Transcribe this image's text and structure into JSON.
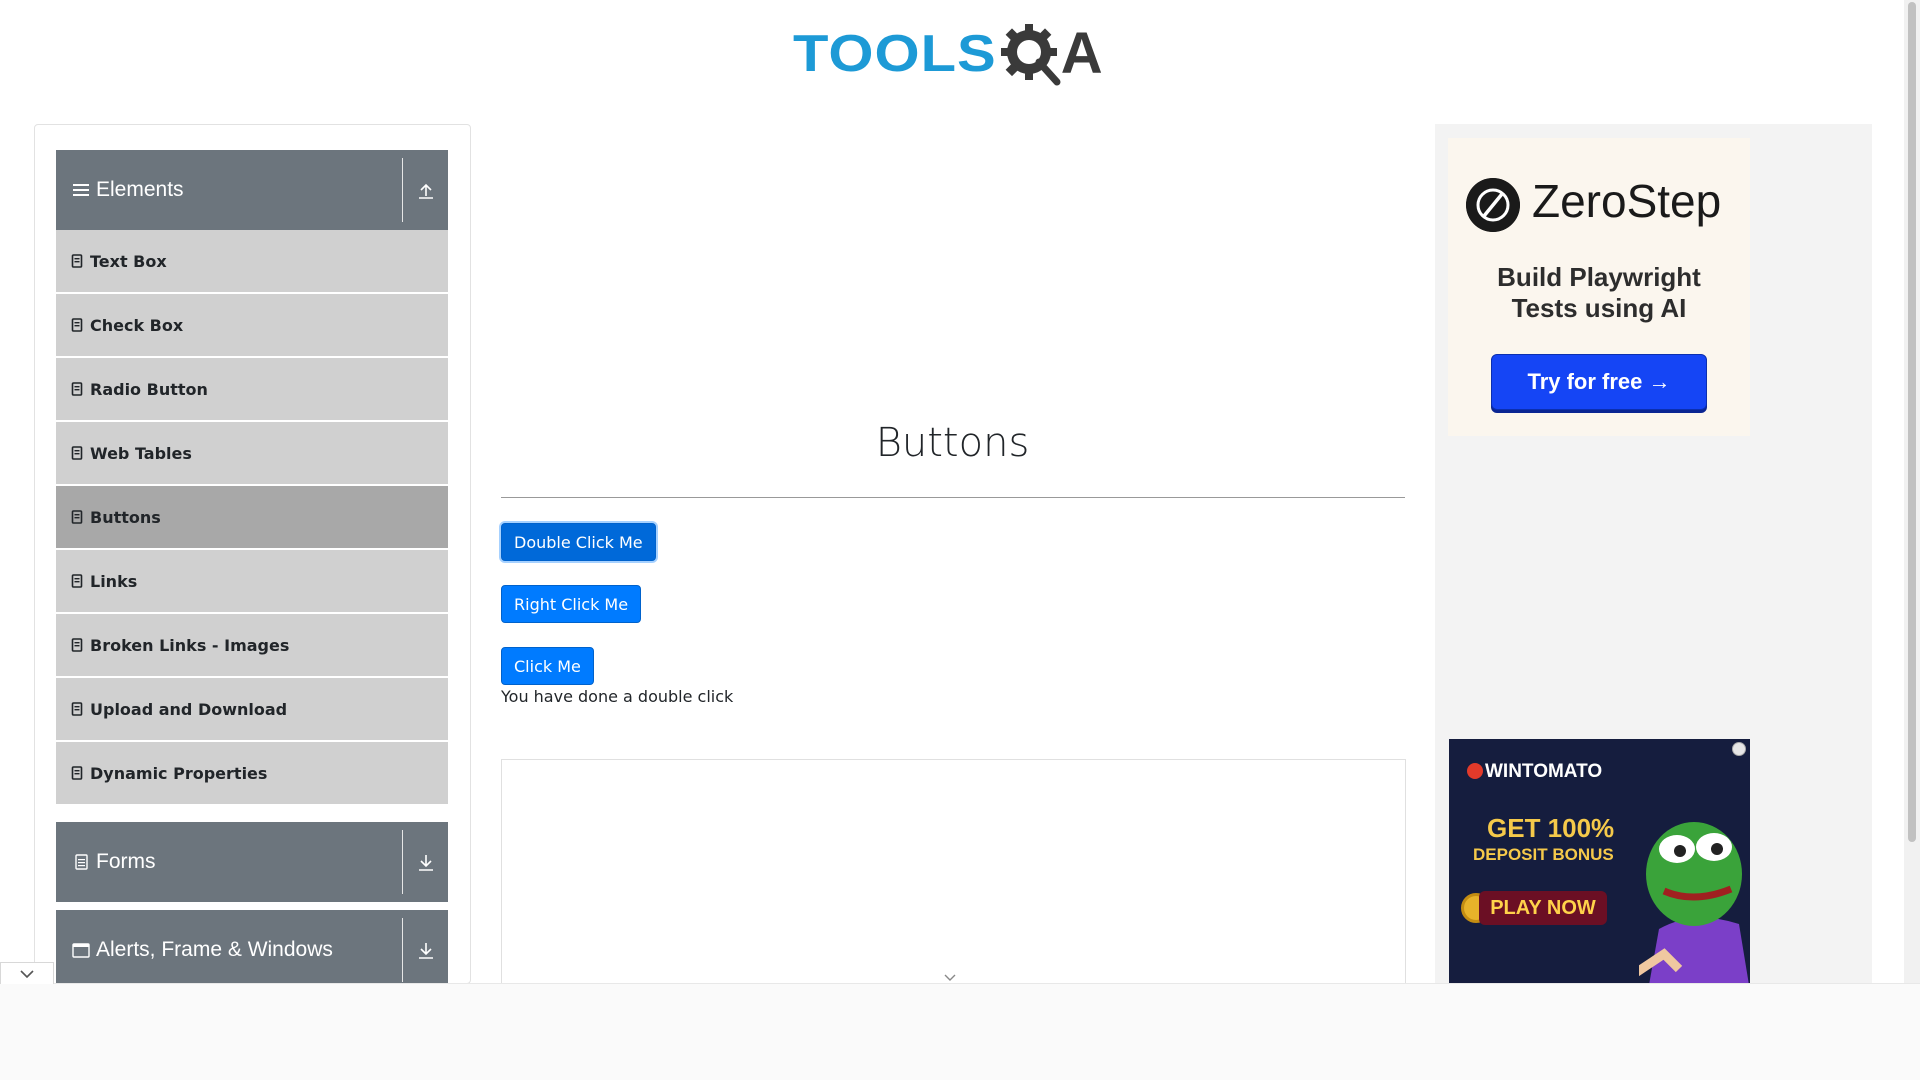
{
  "header": {
    "logo_text_tools": "TOOLS",
    "logo_text_a": "A"
  },
  "sidebar": {
    "groups": [
      {
        "title": "Elements",
        "icon": "hamburger-icon",
        "state": "expanded"
      },
      {
        "title": "Forms",
        "icon": "document-icon",
        "state": "collapsed"
      },
      {
        "title": "Alerts, Frame & Windows",
        "icon": "window-icon",
        "state": "collapsed"
      }
    ],
    "items": [
      {
        "label": "Text Box",
        "active": false
      },
      {
        "label": "Check Box",
        "active": false
      },
      {
        "label": "Radio Button",
        "active": false
      },
      {
        "label": "Web Tables",
        "active": false
      },
      {
        "label": "Buttons",
        "active": true
      },
      {
        "label": "Links",
        "active": false
      },
      {
        "label": "Broken Links - Images",
        "active": false
      },
      {
        "label": "Upload and Download",
        "active": false
      },
      {
        "label": "Dynamic Properties",
        "active": false
      }
    ]
  },
  "main": {
    "title": "Buttons",
    "buttons": [
      {
        "label": "Double Click Me"
      },
      {
        "label": "Right Click Me"
      },
      {
        "label": "Click Me"
      }
    ],
    "message": "You have done a double click"
  },
  "ads": {
    "zerostep": {
      "brand": "ZeroStep",
      "tagline_1": "Build Playwright",
      "tagline_2": "Tests using AI",
      "cta": "Try for free →"
    },
    "wintomato": {
      "brand": "WINTOMATO",
      "headline": "GET 100%",
      "sub": "DEPOSIT BONUS",
      "cta": "PLAY NOW"
    }
  },
  "colors": {
    "primary_button": "#007bff",
    "sidebar_header": "#6c757d",
    "sidebar_item": "#d0d0d0",
    "sidebar_item_active": "#a8a8a8",
    "logo_blue": "#1d9ad6"
  }
}
